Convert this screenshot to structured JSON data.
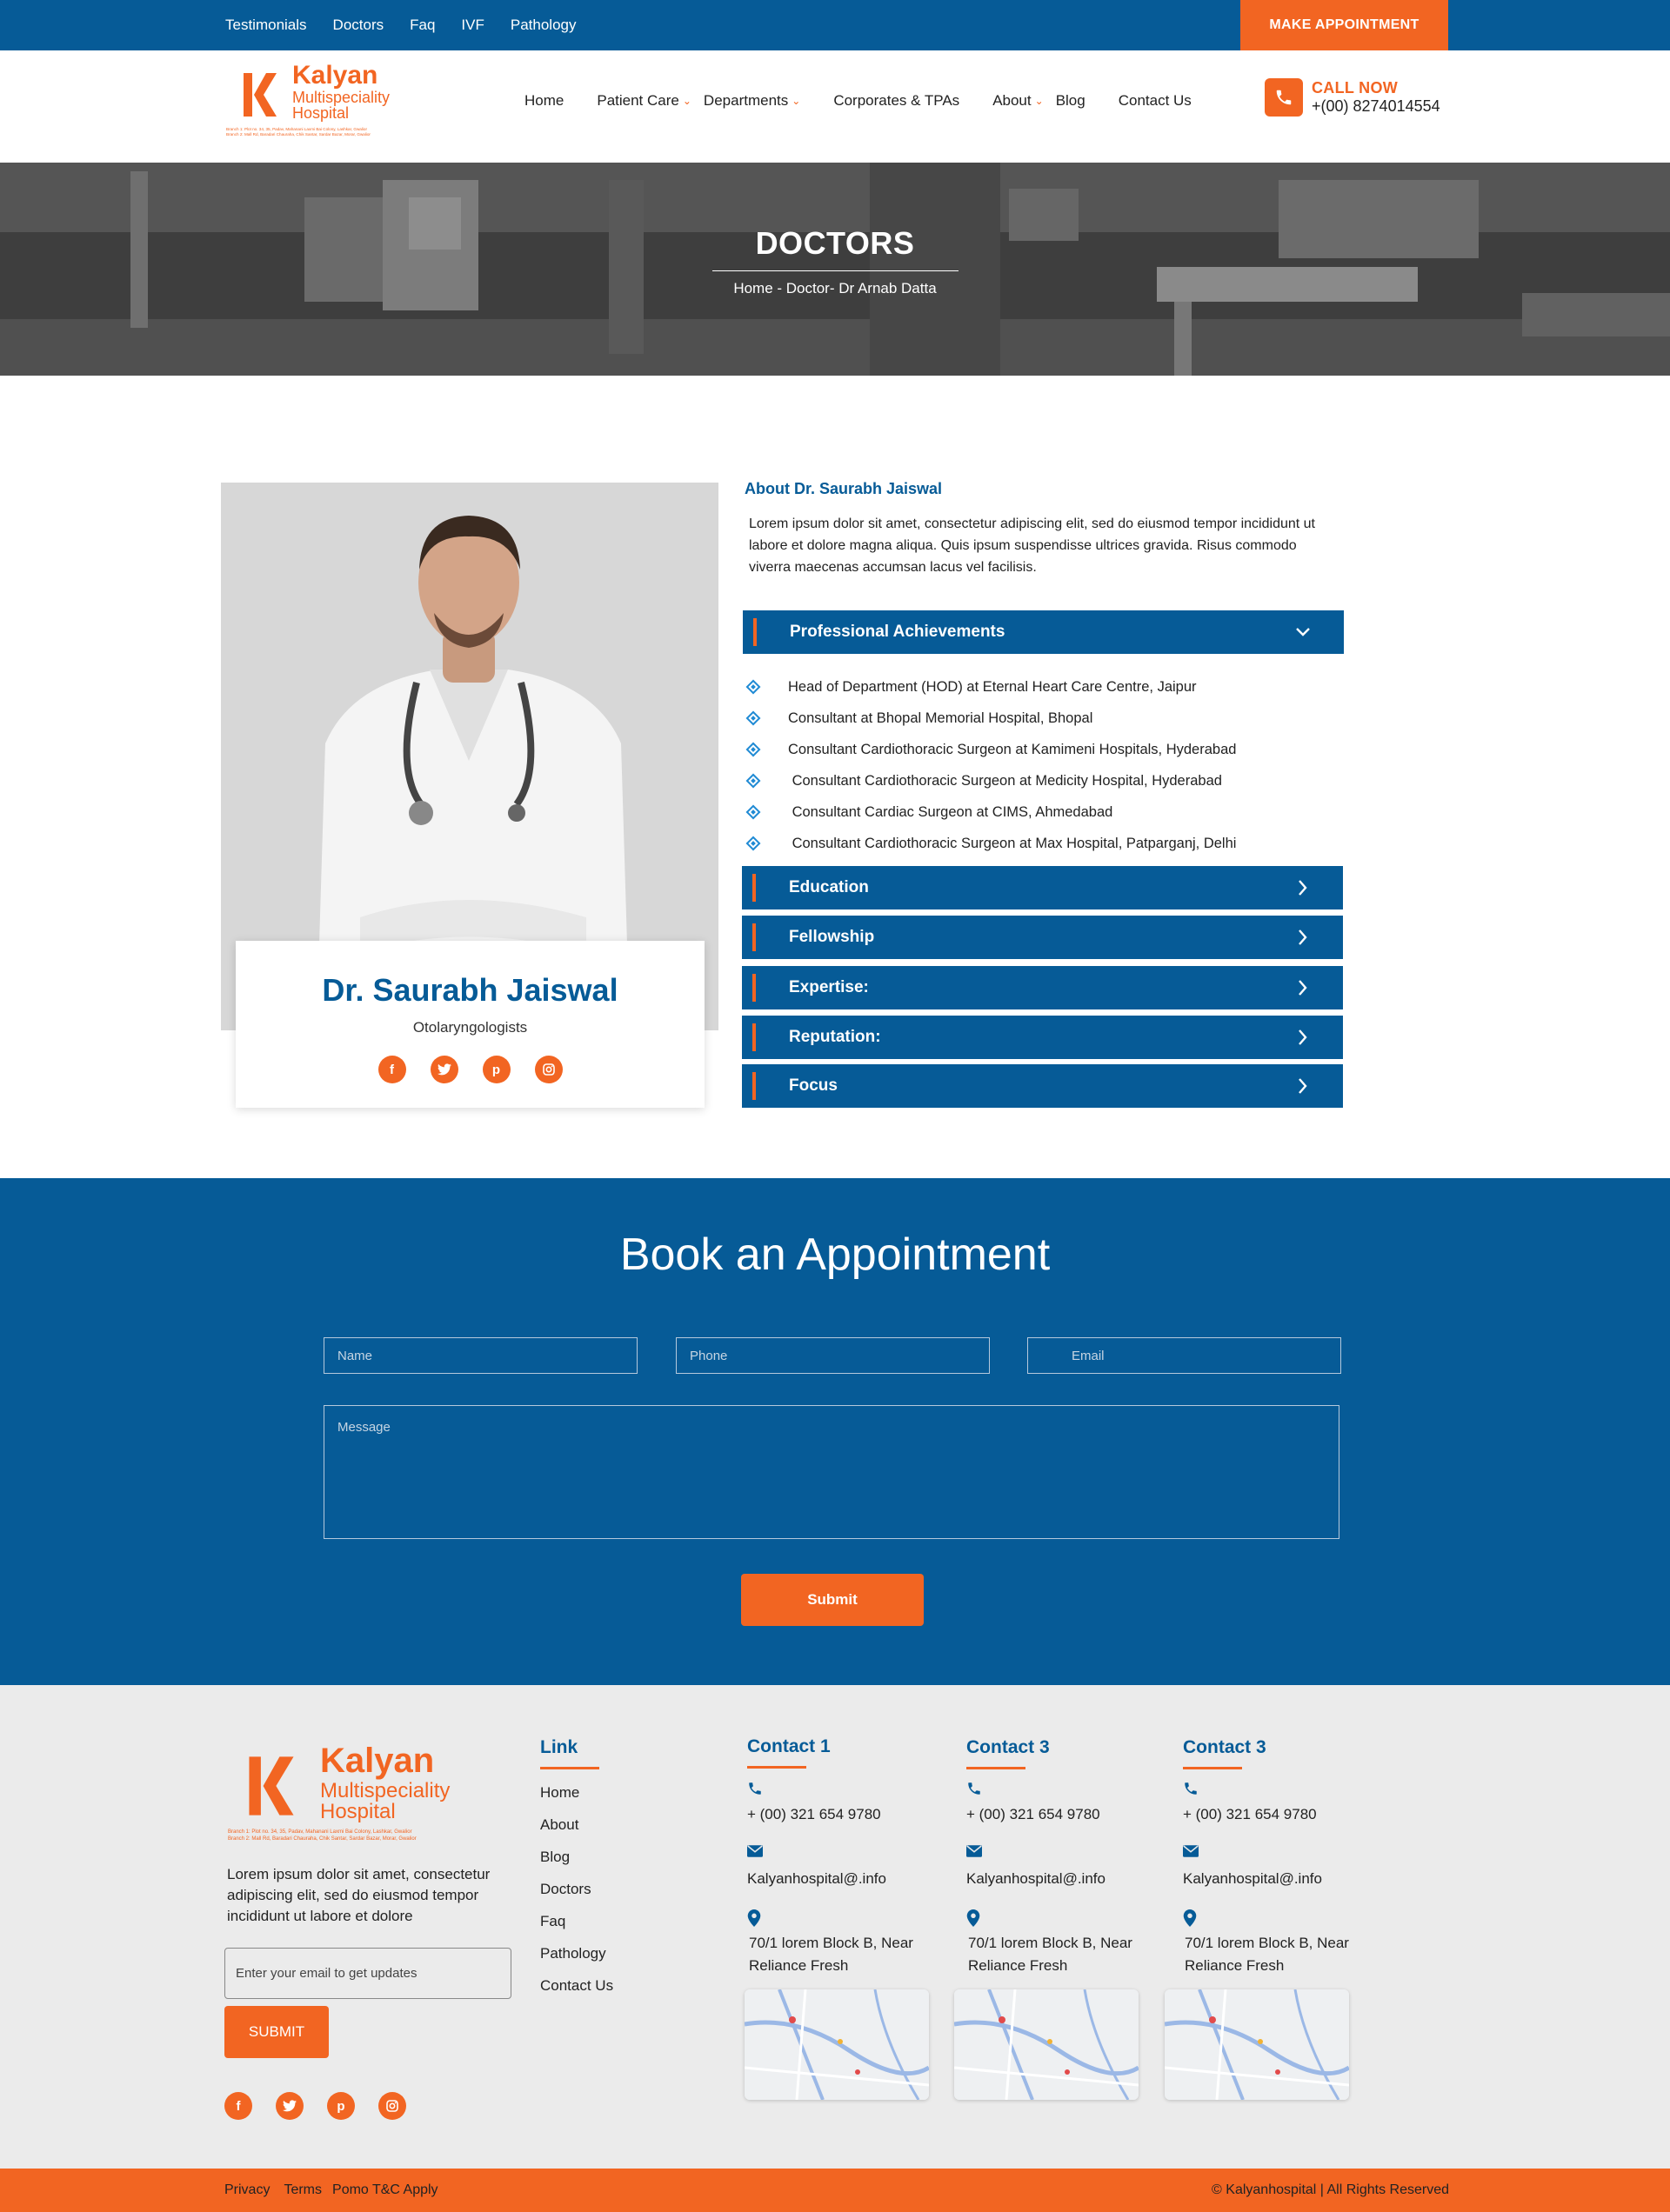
{
  "topbar": {
    "links": [
      "Testimonials",
      "Doctors",
      "Faq",
      "IVF",
      "Pathology"
    ],
    "make_appointment": "MAKE APPOINTMENT"
  },
  "logo": {
    "name": "Kalyan",
    "line2": "Multispeciality",
    "line3": "Hospital",
    "branch1": "Branch 1: Plot no. 34, 35, Padav, Mahanani Laxmi Bai Colony, Lashkar, Gwalior",
    "branch2": "Branch 2: Mall Rd, Baradari Chauraha, Chik Santar, Sardar Bazar, Morar, Gwalior"
  },
  "nav": {
    "home": "Home",
    "patient_care": "Patient Care",
    "departments": "Departments",
    "corporates": "Corporates & TPAs",
    "about": "About",
    "blog": "Blog",
    "contact": "Contact Us"
  },
  "call": {
    "label": "CALL NOW",
    "number": "+(00) 8274014554"
  },
  "hero": {
    "title": "DOCTORS",
    "breadcrumb": "Home - Doctor- Dr Arnab Datta"
  },
  "doctor": {
    "name": "Dr. Saurabh Jaiswal",
    "specialty": "Otolaryngologists",
    "about_heading": "About Dr. Saurabh Jaiswal",
    "about_text": "Lorem ipsum dolor sit amet, consectetur adipiscing elit, sed do eiusmod tempor incididunt ut labore et dolore magna aliqua. Quis ipsum suspendisse ultrices gravida. Risus commodo viverra maecenas accumsan lacus vel facilisis."
  },
  "accordion": {
    "achievements": "Professional Achievements",
    "achievement_items": [
      "Head of Department (HOD) at Eternal Heart Care Centre, Jaipur",
      "Consultant at Bhopal Memorial Hospital, Bhopal",
      "Consultant Cardiothoracic Surgeon at Kamimeni Hospitals, Hyderabad",
      " Consultant Cardiothoracic Surgeon at Medicity Hospital, Hyderabad",
      " Consultant Cardiac Surgeon at CIMS, Ahmedabad",
      " Consultant Cardiothoracic Surgeon at Max Hospital, Patparganj, Delhi"
    ],
    "education": "Education",
    "fellowship": "Fellowship",
    "expertise": "Expertise:",
    "reputation": "Reputation:",
    "focus": "Focus"
  },
  "booking": {
    "title": "Book an Appointment",
    "name_ph": "Name",
    "phone_ph": "Phone",
    "email_ph": "Email",
    "message_ph": "Message",
    "submit": "Submit"
  },
  "footer": {
    "desc": "Lorem ipsum dolor sit amet, consectetur adipiscing elit, sed do eiusmod tempor incididunt ut labore et dolore",
    "email_ph": "Enter your email to get updates",
    "submit": "SUBMIT",
    "link_heading": "Link",
    "links": [
      "Home",
      "About",
      "Blog",
      "Doctors",
      "Faq",
      "Pathology",
      "Contact Us"
    ],
    "contacts": [
      {
        "heading": "Contact 1",
        "phone": "+ (00) 321 654 9780",
        "email": "Kalyanhospital@.info",
        "address": "70/1 lorem Block B, Near Reliance Fresh"
      },
      {
        "heading": "Contact 3",
        "phone": "+ (00) 321 654 9780",
        "email": "Kalyanhospital@.info",
        "address": "70/1 lorem Block B, Near Reliance Fresh"
      },
      {
        "heading": "Contact 3",
        "phone": "+ (00) 321 654 9780",
        "email": "Kalyanhospital@.info",
        "address": "70/1 lorem Block B, Near Reliance Fresh"
      }
    ]
  },
  "bottom": {
    "privacy": "Privacy",
    "terms": "Terms",
    "promo": "Pomo T&C Apply",
    "copyright": "© Kalyanhospital | All Rights Reserved"
  },
  "colors": {
    "primary": "#065b97",
    "accent": "#f26522"
  }
}
